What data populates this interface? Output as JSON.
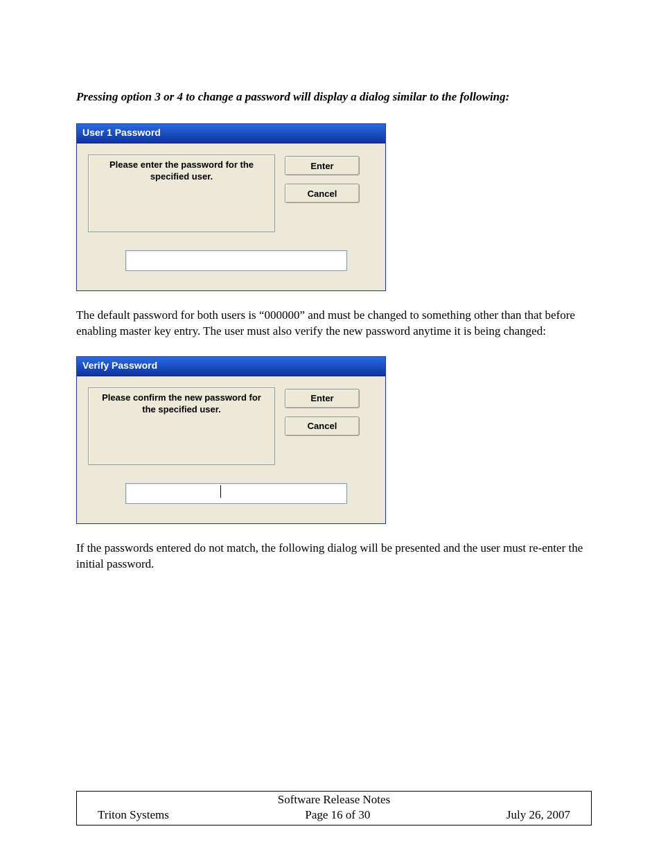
{
  "intro": "Pressing option 3 or 4 to change a password will display a dialog similar to the following:",
  "dialog1": {
    "title": "User 1 Password",
    "message": "Please enter the password for the specified user.",
    "enter": "Enter",
    "cancel": "Cancel",
    "input_value": ""
  },
  "para2": "The default password for both users is “000000” and must be changed to something other than that before enabling master key entry.  The user must also verify the new password anytime it is being changed:",
  "dialog2": {
    "title": "Verify Password",
    "message": "Please confirm the new password for the specified user.",
    "enter": "Enter",
    "cancel": "Cancel",
    "input_value": ""
  },
  "para3": "If the passwords entered do not match, the following dialog will be presented and the user must re-enter the initial password.",
  "footer": {
    "title": "Software Release Notes",
    "left": "Triton Systems",
    "center": "Page 16 of 30",
    "right": "July 26, 2007"
  }
}
